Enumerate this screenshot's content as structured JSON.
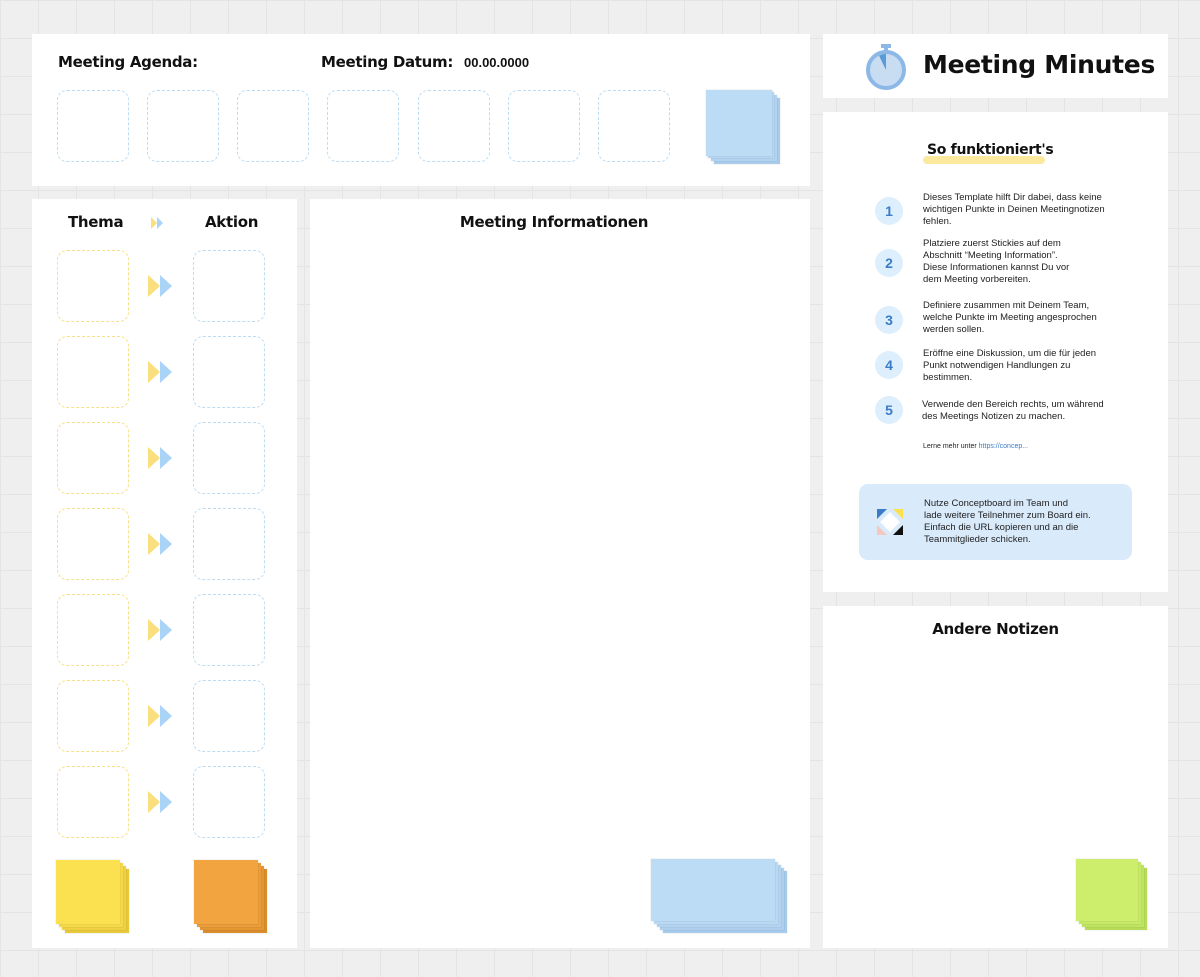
{
  "agenda": {
    "label": "Meeting Agenda:",
    "date_label": "Meeting Datum:",
    "date_value": "00.00.0000"
  },
  "header": {
    "title": "Meeting Minutes",
    "icon": "stopwatch-icon"
  },
  "howto": {
    "title": "So funktioniert's",
    "steps": [
      {
        "num": "1",
        "text": "Dieses Template hilft Dir dabei, dass keine\nwichtigen Punkte in Deinen Meetingnotizen\nfehlen."
      },
      {
        "num": "2",
        "text": "Platziere zuerst Stickies auf dem\nAbschnitt “Meeting Information”.\nDiese Informationen kannst Du vor\ndem Meeting vorbereiten."
      },
      {
        "num": "3",
        "text": "Definiere zusammen mit Deinem Team,\nwelche Punkte im Meeting angesprochen\nwerden sollen."
      },
      {
        "num": "4",
        "text": "Eröffne eine Diskussion, um die für jeden\nPunkt notwendigen Handlungen zu\nbestimmen."
      },
      {
        "num": "5",
        "text": "Verwende den Bereich rechts, um während\ndes Meetings Notizen zu machen."
      }
    ],
    "learn_more": "Lerne mehr unter",
    "link": "https://concep...",
    "info": "Nutze Conceptboard im Team und\nlade weitere Teilnehmer zum Board ein.\nEinfach die URL kopieren und an die\nTeammitglieder schicken."
  },
  "topics": {
    "thema": "Thema",
    "aktion": "Aktion"
  },
  "info_panel": {
    "title": "Meeting Informationen"
  },
  "notes": {
    "title": "Andere Notizen"
  },
  "colors": {
    "blue_sticky": "#bcdcf6",
    "yellow_sticky": "#fbe04f",
    "orange_sticky": "#f1a43f",
    "green_sticky": "#cdee6c",
    "accent_blue": "#3a7cc7"
  }
}
